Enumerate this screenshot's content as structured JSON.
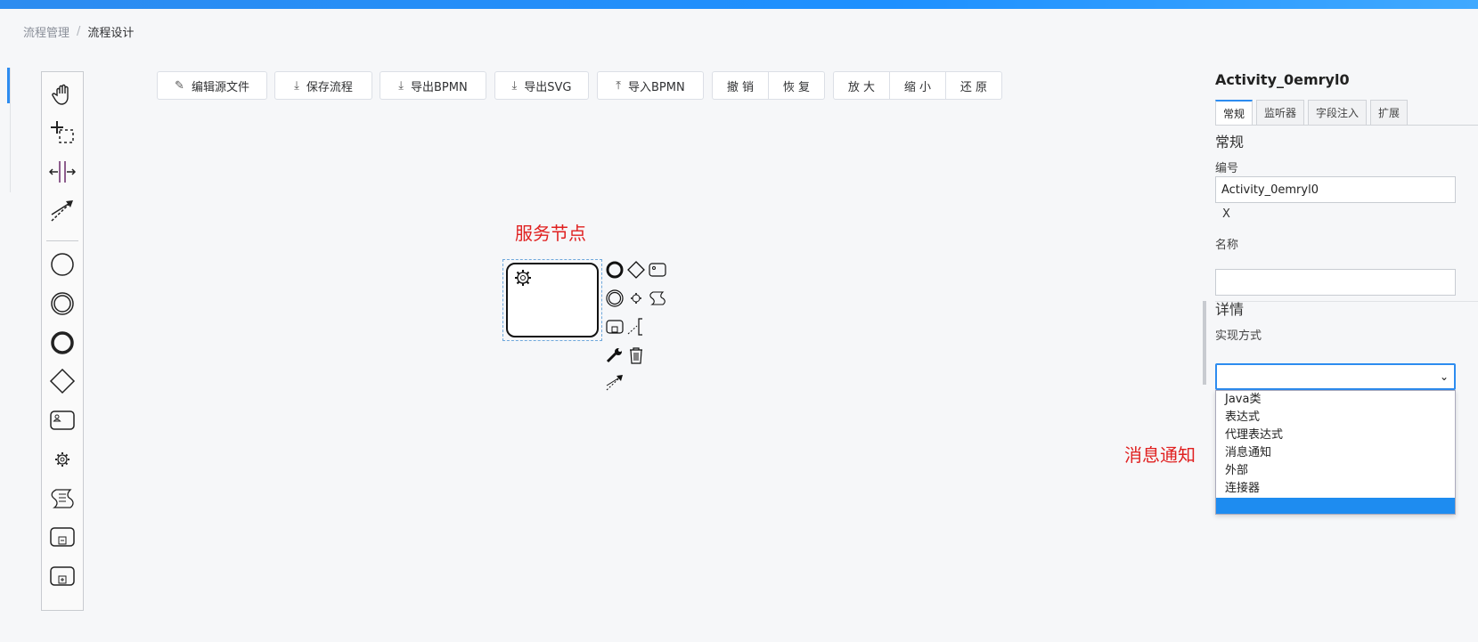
{
  "breadcrumb": {
    "parent": "流程管理",
    "separator": "/",
    "current": "流程设计"
  },
  "toolbar": {
    "edit_source": "编辑源文件",
    "save": "保存流程",
    "export_bpmn": "导出BPMN",
    "export_svg": "导出SVG",
    "import_bpmn": "导入BPMN",
    "undo": "撤 销",
    "redo": "恢 复",
    "zoom_in": "放 大",
    "zoom_out": "缩 小",
    "reset": "还 原"
  },
  "palette": {
    "tools": [
      "hand-tool",
      "lasso-tool",
      "space-tool",
      "global-connect-tool",
      "start-event",
      "intermediate-event",
      "end-event",
      "gateway",
      "user-task",
      "service-task",
      "script-task",
      "collapsed-subprocess",
      "expanded-subprocess"
    ]
  },
  "canvas": {
    "node_annotation": "服务节点",
    "context_pad": [
      "end-event",
      "gateway",
      "user-task",
      "intermediate-event",
      "service-task",
      "script-task",
      "subprocess",
      "text-annotation",
      "wrench",
      "delete",
      "connect"
    ]
  },
  "panel": {
    "element_id_title": "Activity_0emryl0",
    "tabs": [
      "常规",
      "监听器",
      "字段注入",
      "扩展"
    ],
    "active_tab": "常规",
    "general_heading": "常规",
    "id_label": "编号",
    "id_value": "Activity_0emryl0",
    "clear_x": "X",
    "name_label": "名称",
    "name_value": "",
    "details_heading": "详情",
    "impl_label": "实现方式",
    "impl_selected": "",
    "impl_options": [
      "Java类",
      "表达式",
      "代理表达式",
      "消息通知",
      "外部",
      "连接器",
      ""
    ]
  },
  "annotation": "消息通知",
  "colors": {
    "accent": "#2d8cf0",
    "annotation": "#e02020",
    "topbar": "#2d8cf0"
  }
}
